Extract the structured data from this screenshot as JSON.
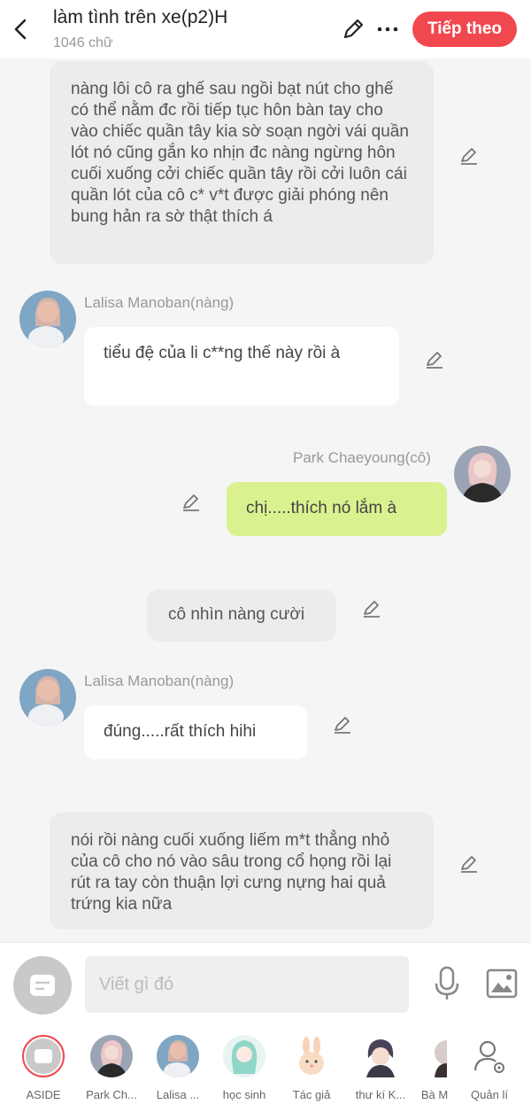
{
  "header": {
    "title": "làm tình trên xe(p2)H",
    "word_count": "1046 chữ",
    "next_label": "Tiếp theo",
    "accent_color": "#f0484e"
  },
  "messages": [
    {
      "type": "narration",
      "text": "nàng lôi cô ra ghế sau ngồi bạt nút cho ghế có thể nằm đc rồi tiếp tục hôn bàn tay cho vào chiếc quần tây kia sờ soạn ngời vái quần lót nó cũng gắn ko nhịn đc nàng ngừng hôn cuối xuống cởi chiếc quần tây rồi cởi luôn cái quần lót của cô c* v*t được giải phóng nên bung hản ra sờ thật thích á"
    },
    {
      "type": "left",
      "name": "Lalisa Manoban(nàng)",
      "text": "tiểu đệ của li c**ng thế này rồi à"
    },
    {
      "type": "right",
      "name": "Park Chaeyoung(cô)",
      "text": "chị.....thích nó lắm à"
    },
    {
      "type": "narration",
      "text": "cô nhìn nàng cười"
    },
    {
      "type": "left",
      "name": "Lalisa Manoban(nàng)",
      "text": "đúng.....rất thích hihi"
    },
    {
      "type": "narration",
      "text": "nói rồi nàng cuối xuống liếm m*t thẳng nhỏ của cô cho nó vào sâu trong cổ họng rồi lại rút ra tay còn thuận lợi cưng nựng hai quả trứng kia nữa"
    }
  ],
  "input": {
    "placeholder": "Viết gì đó"
  },
  "tabs": [
    {
      "label": "ASIDE"
    },
    {
      "label": "Park Ch..."
    },
    {
      "label": "Lalisa ..."
    },
    {
      "label": "học sinh"
    },
    {
      "label": "Tác giả"
    },
    {
      "label": "thư kí K..."
    },
    {
      "label": "Bà M"
    },
    {
      "label": "Quản lí"
    }
  ]
}
